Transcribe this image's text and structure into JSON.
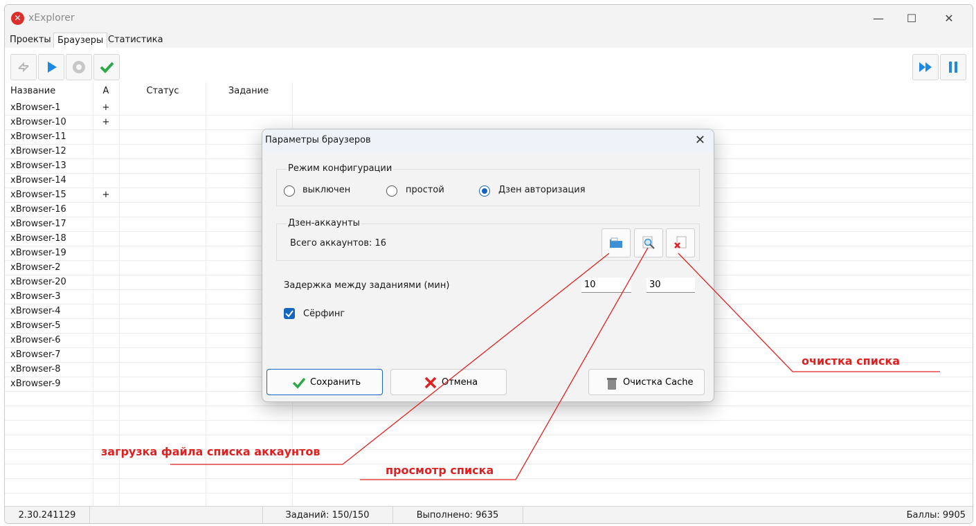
{
  "app": {
    "title": "xExplorer",
    "icon": "app-logo-icon"
  },
  "window_controls": {
    "minimize": "—",
    "maximize": "☐",
    "close": "✕"
  },
  "tabs": [
    {
      "label": "Проекты"
    },
    {
      "label": "Браузеры"
    },
    {
      "label": "Статистика"
    }
  ],
  "toolbar": {
    "left_icons": [
      "refresh-icon",
      "play-icon",
      "gear-icon",
      "checkmark-icon"
    ],
    "right_icons": [
      "fast-forward-icon",
      "pause-icon"
    ]
  },
  "table": {
    "headers": [
      "Название",
      "A",
      "Статус",
      "Задание"
    ],
    "rows": [
      {
        "name": "xBrowser-1",
        "a": "+"
      },
      {
        "name": "xBrowser-10",
        "a": "+"
      },
      {
        "name": "xBrowser-11",
        "a": ""
      },
      {
        "name": "xBrowser-12",
        "a": ""
      },
      {
        "name": "xBrowser-13",
        "a": ""
      },
      {
        "name": "xBrowser-14",
        "a": ""
      },
      {
        "name": "xBrowser-15",
        "a": "+"
      },
      {
        "name": "xBrowser-16",
        "a": ""
      },
      {
        "name": "xBrowser-17",
        "a": ""
      },
      {
        "name": "xBrowser-18",
        "a": ""
      },
      {
        "name": "xBrowser-19",
        "a": ""
      },
      {
        "name": "xBrowser-2",
        "a": ""
      },
      {
        "name": "xBrowser-20",
        "a": ""
      },
      {
        "name": "xBrowser-3",
        "a": ""
      },
      {
        "name": "xBrowser-4",
        "a": ""
      },
      {
        "name": "xBrowser-5",
        "a": ""
      },
      {
        "name": "xBrowser-6",
        "a": ""
      },
      {
        "name": "xBrowser-7",
        "a": ""
      },
      {
        "name": "xBrowser-8",
        "a": ""
      },
      {
        "name": "xBrowser-9",
        "a": ""
      }
    ]
  },
  "statusbar": {
    "version": "2.30.241129",
    "tasks": "Заданий: 150/150",
    "done": "Выполнено: 9635",
    "points": "Баллы: 9905"
  },
  "dialog": {
    "title": "Параметры браузеров",
    "close": "✕",
    "config_mode": {
      "legend": "Режим конфигурации",
      "options": [
        "выключен",
        "простой",
        "Дзен авторизация"
      ],
      "selected": "Дзен авторизация"
    },
    "accounts": {
      "legend": "Дзен-аккаунты",
      "total": "Всего аккаунтов: 16",
      "buttons": [
        "open-folder-icon",
        "magnifier-icon",
        "delete-file-icon"
      ]
    },
    "delay": {
      "label": "Задержка между заданиями (мин)",
      "min": "10",
      "max": "30"
    },
    "surfing": {
      "label": "Сёрфинг",
      "checked": true
    },
    "buttons": {
      "save": "Сохранить",
      "cancel": "Отмена",
      "clear_cache": "Очистка Cache"
    }
  },
  "annotations": {
    "load_file": "загрузка файла списка аккаунтов",
    "view_list": "просмотр списка",
    "clear_list": "очистка списка",
    "color": "#e02020"
  },
  "colors": {
    "accent": "#1565c0",
    "annotation": "#e02020"
  }
}
